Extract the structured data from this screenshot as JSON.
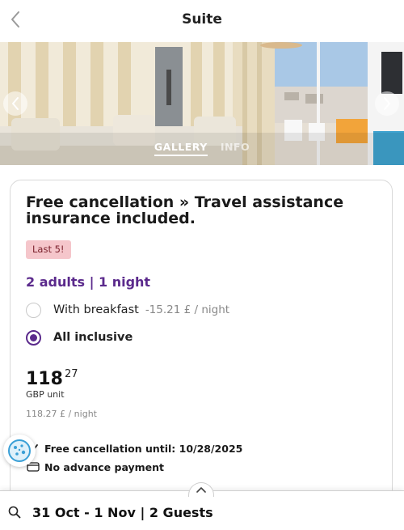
{
  "header": {
    "title": "Suite",
    "back_icon": "chevron-left-icon"
  },
  "gallery": {
    "tabs": [
      {
        "label": "GALLERY",
        "active": true
      },
      {
        "label": "INFO",
        "active": false
      }
    ],
    "prev_icon": "chevron-left-icon",
    "next_icon": "chevron-right-icon"
  },
  "rate": {
    "title": "Free cancellation » Travel assistance insurance included.",
    "badge": "Last 5!",
    "occupancy": "2 adults | 1 night",
    "options": [
      {
        "label": "With breakfast",
        "extra": "-15.21 £ / night",
        "selected": false
      },
      {
        "label": "All inclusive",
        "extra": "",
        "selected": true
      }
    ],
    "price": {
      "integer": "118",
      "decimal": "27",
      "unit": "GBP unit",
      "per_night": "118.27 £ / night"
    },
    "policies": [
      {
        "text": "Free cancellation until: 10/28/2025",
        "icon": "check-icon"
      },
      {
        "text": "No advance payment",
        "icon": "card-icon"
      }
    ]
  },
  "bottom_bar": {
    "summary": "31 Oct - 1 Nov | 2 Guests",
    "search_icon": "search-icon",
    "expand_icon": "chevron-up-icon"
  },
  "cookie": {
    "icon": "cookie-icon"
  },
  "colors": {
    "accent": "#5b2a8c",
    "badge_bg": "#f5c6cb",
    "border": "#d9d9d9"
  }
}
